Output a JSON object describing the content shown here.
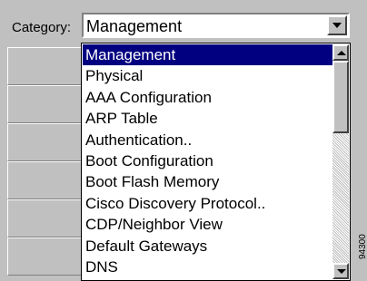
{
  "category": {
    "label": "Category:",
    "selected_value": "Management"
  },
  "dropdown": {
    "items": [
      {
        "label": "Management",
        "selected": true
      },
      {
        "label": "Physical",
        "selected": false
      },
      {
        "label": "AAA Configuration",
        "selected": false
      },
      {
        "label": "ARP Table",
        "selected": false
      },
      {
        "label": "Authentication..",
        "selected": false
      },
      {
        "label": "Boot Configuration",
        "selected": false
      },
      {
        "label": "Boot Flash Memory",
        "selected": false
      },
      {
        "label": "Cisco Discovery Protocol..",
        "selected": false
      },
      {
        "label": "CDP/Neighbor View",
        "selected": false
      },
      {
        "label": "Default Gateways",
        "selected": false
      },
      {
        "label": "DNS",
        "selected": false
      }
    ]
  },
  "figure_id": "94300",
  "colors": {
    "selection": "#000080",
    "panel": "#c0c0c0"
  }
}
